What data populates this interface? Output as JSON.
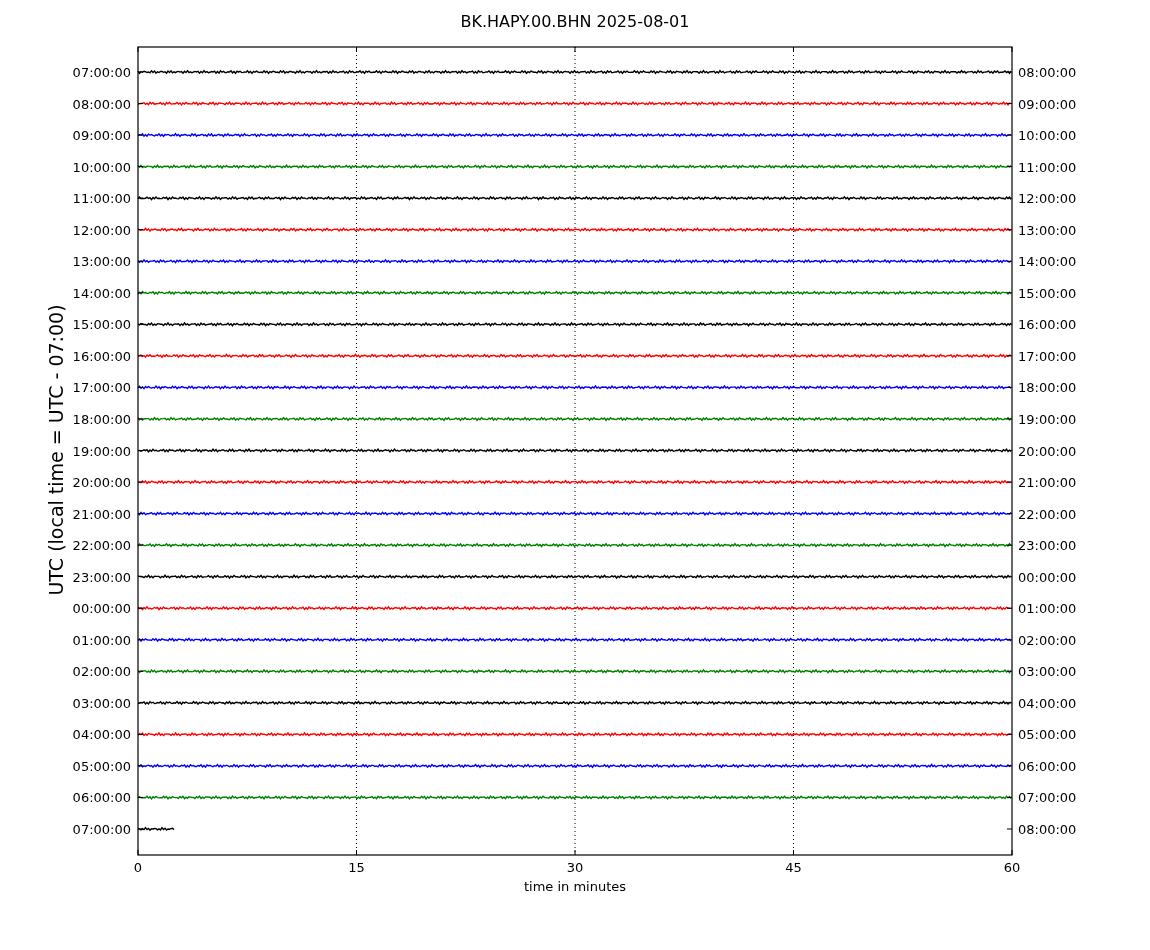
{
  "title": "BK.HAPY.00.BHN 2025-08-01",
  "ylabel": "UTC (local time = UTC - 07:00)",
  "xlabel": "time in minutes",
  "xticks": [
    "0",
    "15",
    "30",
    "45",
    "60"
  ],
  "rows": [
    {
      "left": "07:00:00",
      "right": "08:00:00",
      "color": "#000000",
      "kind": "full"
    },
    {
      "left": "08:00:00",
      "right": "09:00:00",
      "color": "#ff0000",
      "kind": "full"
    },
    {
      "left": "09:00:00",
      "right": "10:00:00",
      "color": "#0000ff",
      "kind": "full"
    },
    {
      "left": "10:00:00",
      "right": "11:00:00",
      "color": "#008000",
      "kind": "full"
    },
    {
      "left": "11:00:00",
      "right": "12:00:00",
      "color": "#000000",
      "kind": "full"
    },
    {
      "left": "12:00:00",
      "right": "13:00:00",
      "color": "#ff0000",
      "kind": "full"
    },
    {
      "left": "13:00:00",
      "right": "14:00:00",
      "color": "#0000ff",
      "kind": "full"
    },
    {
      "left": "14:00:00",
      "right": "15:00:00",
      "color": "#008000",
      "kind": "full"
    },
    {
      "left": "15:00:00",
      "right": "16:00:00",
      "color": "#000000",
      "kind": "full"
    },
    {
      "left": "16:00:00",
      "right": "17:00:00",
      "color": "#ff0000",
      "kind": "full"
    },
    {
      "left": "17:00:00",
      "right": "18:00:00",
      "color": "#0000ff",
      "kind": "full"
    },
    {
      "left": "18:00:00",
      "right": "19:00:00",
      "color": "#008000",
      "kind": "full"
    },
    {
      "left": "19:00:00",
      "right": "20:00:00",
      "color": "#000000",
      "kind": "full"
    },
    {
      "left": "20:00:00",
      "right": "21:00:00",
      "color": "#ff0000",
      "kind": "full"
    },
    {
      "left": "21:00:00",
      "right": "22:00:00",
      "color": "#0000ff",
      "kind": "full"
    },
    {
      "left": "22:00:00",
      "right": "23:00:00",
      "color": "#008000",
      "kind": "full"
    },
    {
      "left": "23:00:00",
      "right": "00:00:00",
      "color": "#000000",
      "kind": "full"
    },
    {
      "left": "00:00:00",
      "right": "01:00:00",
      "color": "#ff0000",
      "kind": "full"
    },
    {
      "left": "01:00:00",
      "right": "02:00:00",
      "color": "#0000ff",
      "kind": "full"
    },
    {
      "left": "02:00:00",
      "right": "03:00:00",
      "color": "#008000",
      "kind": "full"
    },
    {
      "left": "03:00:00",
      "right": "04:00:00",
      "color": "#000000",
      "kind": "full"
    },
    {
      "left": "04:00:00",
      "right": "05:00:00",
      "color": "#ff0000",
      "kind": "full"
    },
    {
      "left": "05:00:00",
      "right": "06:00:00",
      "color": "#0000ff",
      "kind": "full"
    },
    {
      "left": "06:00:00",
      "right": "07:00:00",
      "color": "#008000",
      "kind": "full"
    },
    {
      "left": "07:00:00",
      "right": "08:00:00",
      "color": "#000000",
      "kind": "partial"
    }
  ]
}
